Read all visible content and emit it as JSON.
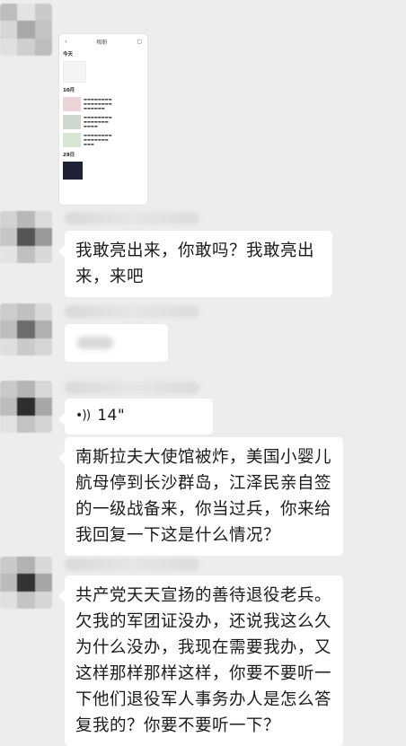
{
  "chat": {
    "image_message": {
      "title": "相册",
      "labels": [
        "今天",
        "10月",
        "29日"
      ]
    },
    "messages": [
      {
        "id": "m1",
        "text": "我敢亮出来，你敢吗？我敢亮出来，来吧"
      },
      {
        "id": "m3",
        "type": "voice",
        "duration": "14\""
      },
      {
        "id": "m4",
        "text": "南斯拉夫大使馆被炸，美国小婴儿航母停到长沙群岛，江泽民亲自签的一级战备来，你当过兵，你来给我回复一下这是什么情况？"
      },
      {
        "id": "m5",
        "text": "共产党天天宣扬的善待退役老兵。欠我的军团证没办，还说我这么久为什么没办，我现在需要我办，又这样那样那样这样，你要不要听一下他们退役军人事务办人是怎么答复我的？你要不要听一下？"
      }
    ]
  },
  "colors": {
    "background": "#ededed",
    "bubble": "#ffffff",
    "text": "#1b1b1b"
  }
}
